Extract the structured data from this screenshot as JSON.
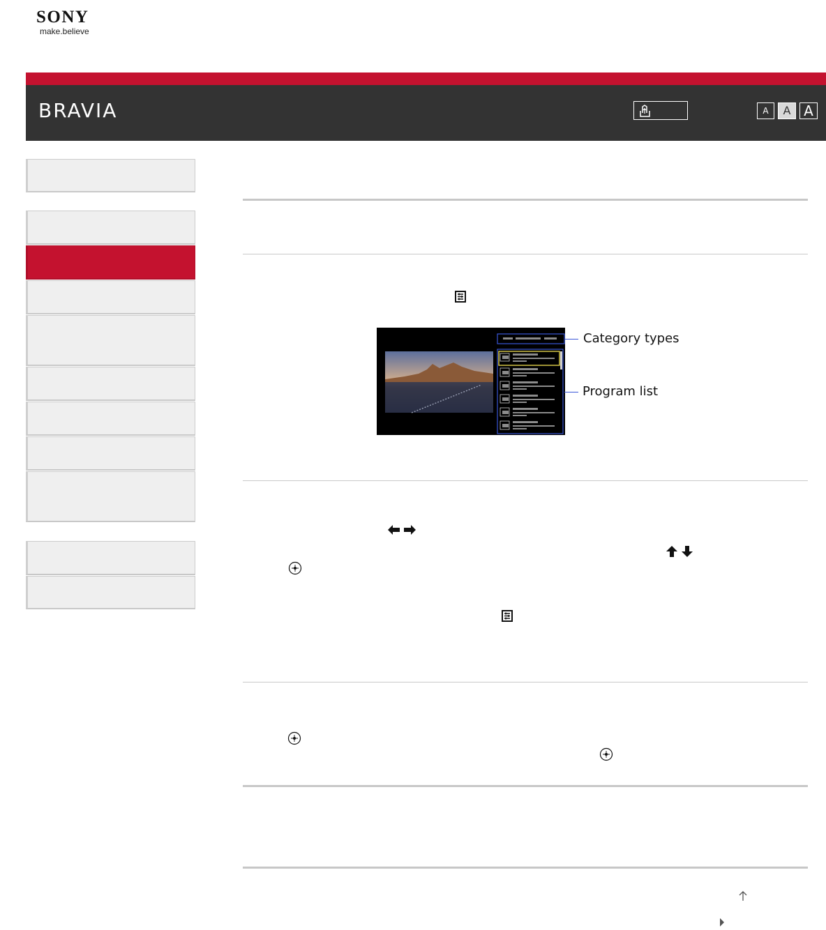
{
  "header": {
    "brand": "SONY",
    "tagline": "make.believe",
    "product": "BRAVIA",
    "font_sizes": [
      "A",
      "A",
      "A"
    ],
    "accent_color": "#c4122f",
    "bar_color": "#333333"
  },
  "sidebar": {
    "items": [
      {
        "label": "",
        "active": false
      },
      {
        "label": "",
        "active": false
      },
      {
        "label": "",
        "active": true
      },
      {
        "label": "",
        "active": false
      },
      {
        "label": "",
        "active": false
      },
      {
        "label": "",
        "active": false
      },
      {
        "label": "",
        "active": false
      },
      {
        "label": "",
        "active": false
      },
      {
        "label": "",
        "active": false
      },
      {
        "label": "",
        "active": false
      },
      {
        "label": "",
        "active": false
      }
    ]
  },
  "figure": {
    "labels": {
      "category_types": "Category types",
      "program_list": "Program list"
    }
  },
  "icons": [
    "print-icon",
    "options-icon",
    "left-right-arrows-icon",
    "up-down-arrows-icon",
    "enter-button-icon",
    "back-to-top-icon",
    "next-arrow-icon"
  ]
}
